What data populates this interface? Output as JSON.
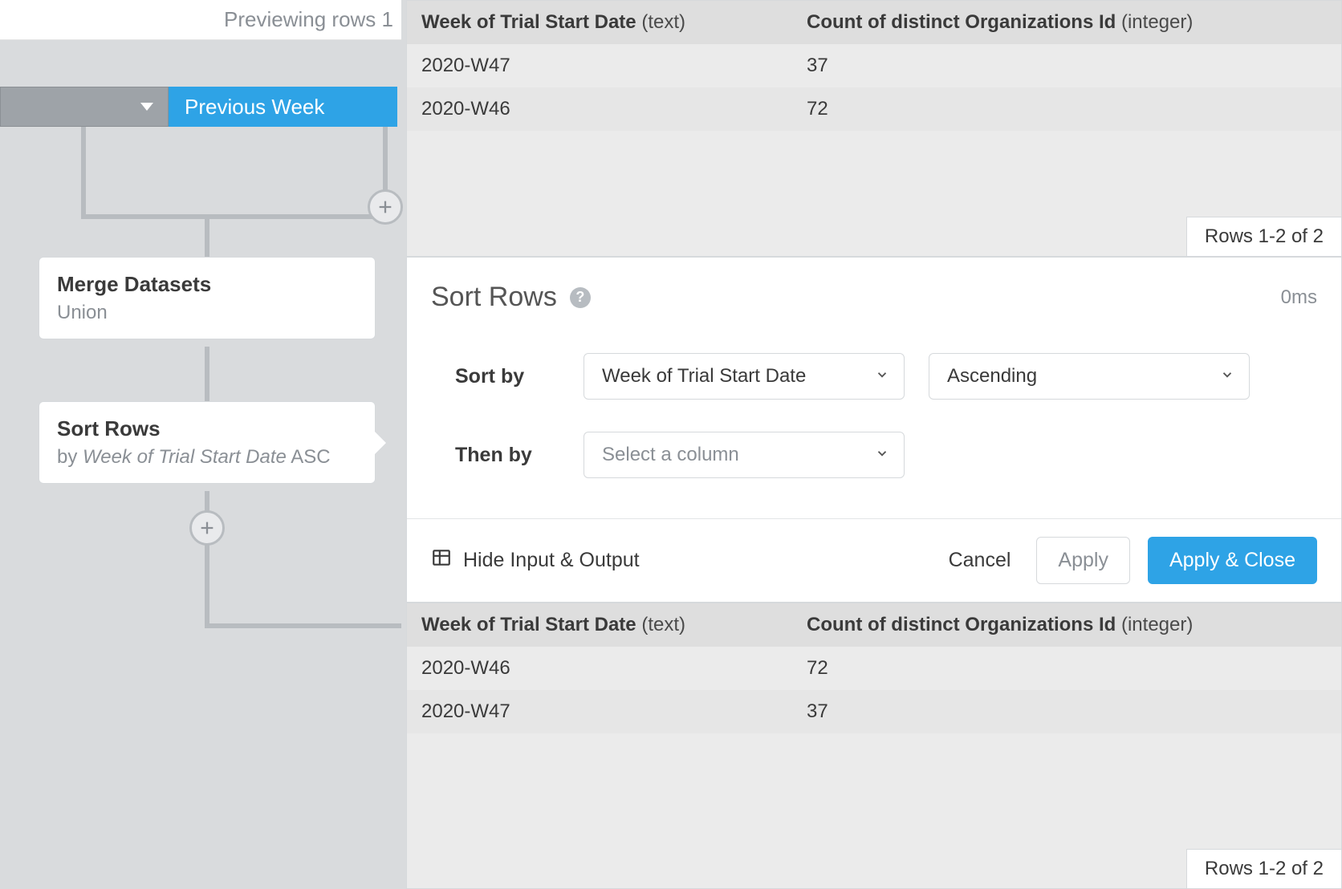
{
  "preview_banner": "Previewing rows 1",
  "tabs": {
    "grey_has_caret": true,
    "blue_label": "Previous Week"
  },
  "nodes": {
    "merge": {
      "title": "Merge Datasets",
      "subtitle": "Union"
    },
    "sort": {
      "title": "Sort Rows",
      "subtitle_by": "by ",
      "subtitle_col": "Week of Trial Start Date",
      "subtitle_dir": " ASC"
    }
  },
  "input_table": {
    "headers": [
      {
        "name": "Week of Trial Start Date",
        "type": " (text)"
      },
      {
        "name": "Count of distinct Organizations Id",
        "type": " (integer)"
      }
    ],
    "rows": [
      {
        "a": "2020-W47",
        "b": "37"
      },
      {
        "a": "2020-W46",
        "b": "72"
      }
    ],
    "rows_badge": "Rows 1-2 of 2"
  },
  "output_table": {
    "headers": [
      {
        "name": "Week of Trial Start Date",
        "type": " (text)"
      },
      {
        "name": "Count of distinct Organizations Id",
        "type": " (integer)"
      }
    ],
    "rows": [
      {
        "a": "2020-W46",
        "b": "72"
      },
      {
        "a": "2020-W47",
        "b": "37"
      }
    ],
    "rows_badge": "Rows 1-2 of 2"
  },
  "config": {
    "title": "Sort Rows",
    "help": "?",
    "time": "0ms",
    "sort_by_label": "Sort by",
    "then_by_label": "Then by",
    "sort_column": "Week of Trial Start Date",
    "sort_order": "Ascending",
    "then_placeholder": "Select a column",
    "hide_io": "Hide Input & Output",
    "cancel": "Cancel",
    "apply": "Apply",
    "apply_close": "Apply & Close"
  }
}
